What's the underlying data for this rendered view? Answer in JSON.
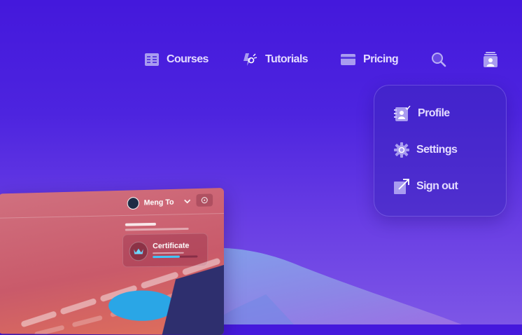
{
  "nav": {
    "items": [
      {
        "label": "Courses",
        "icon": "courses-icon"
      },
      {
        "label": "Tutorials",
        "icon": "tutorials-icon"
      },
      {
        "label": "Pricing",
        "icon": "credit-card-icon"
      }
    ],
    "search_icon": "search-icon",
    "account_icon": "account-icon"
  },
  "menu": {
    "items": [
      {
        "label": "Profile",
        "icon": "profile-icon"
      },
      {
        "label": "Settings",
        "icon": "gear-icon"
      },
      {
        "label": "Sign out",
        "icon": "sign-out-icon"
      }
    ]
  },
  "preview": {
    "user_name": "Meng To",
    "certificate_label": "Certificate",
    "certificate_progress": 0.6
  },
  "colors": {
    "background": "#4418dc",
    "nav_text": "#e4dcff",
    "panel": "#c95a6a",
    "progress_accent": "#3ec8ff"
  }
}
